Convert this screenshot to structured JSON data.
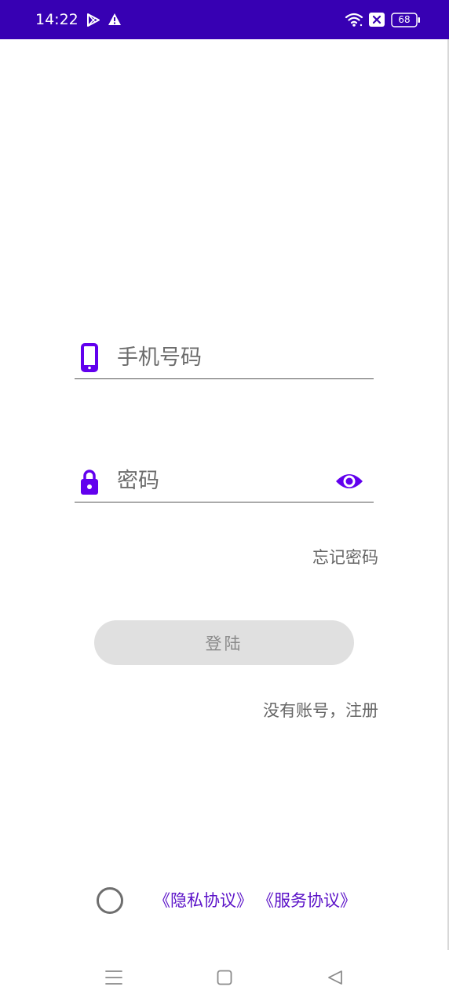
{
  "status_bar": {
    "time": "14:22",
    "battery": "68",
    "background_color": "#3700b3"
  },
  "form": {
    "phone_placeholder": "手机号码",
    "phone_value": "",
    "password_placeholder": "密码",
    "password_value": "",
    "forgot_password": "忘记密码",
    "login_button": "登陆",
    "register_link": "没有账号，注册"
  },
  "agreement": {
    "privacy": "《隐私协议》",
    "service": "《服务协议》"
  },
  "icons": {
    "phone": "smartphone-icon",
    "password": "lock-icon",
    "toggle_visibility": "eye-icon"
  },
  "colors": {
    "accent": "#6200ee",
    "link": "#5b12c8",
    "button_disabled": "#e0e0e0"
  }
}
